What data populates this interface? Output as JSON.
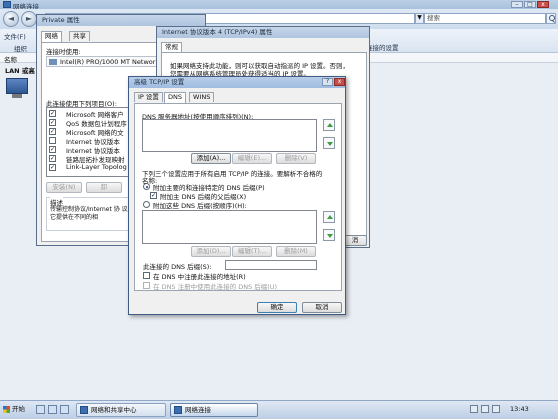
{
  "explorer": {
    "title": "网络连接",
    "search_placeholder": "搜索",
    "menu": [
      "文件(F)",
      "组织"
    ],
    "col_name": "名称",
    "lan_label": "LAN 或高",
    "bg_setting_text": "连接的设置",
    "nav_back": "◄",
    "nav_forward": "►",
    "caption_min": "–",
    "caption_max": "□",
    "caption_close": "x"
  },
  "props_dialog": {
    "title": "Private 属性",
    "tabs": [
      "网络",
      "共享"
    ],
    "connect_using": "连接时使用:",
    "adapter": "Intel(R) PRO/1000 MT Network",
    "items_label": "此连接使用下列项目(O):",
    "items": [
      {
        "checked": "✓",
        "label": "Microsoft 网络客户"
      },
      {
        "checked": "✓",
        "label": "QoS 数据包计划程序"
      },
      {
        "checked": "✓",
        "label": "Microsoft 网络的文"
      },
      {
        "checked": "",
        "label": "Internet 协议版本"
      },
      {
        "checked": "✓",
        "label": "Internet 协议版本"
      },
      {
        "checked": "✓",
        "label": "链路层拓扑发现映射"
      },
      {
        "checked": "✓",
        "label": "Link-Layer Topolog"
      }
    ],
    "install_button": "安装(N)",
    "next_button": "卸",
    "desc_title": "描述",
    "desc_text": "传输控制协议/Internet 协 议。它提供在不同的相"
  },
  "ipv4_dialog": {
    "title": "Internet 协议版本 4 (TCP/IPv4) 属性",
    "tab": "常规",
    "intro_line1": "如果网络支持此功能，则可以获取自动指派的 IP 设置。否则，",
    "intro_line2": "您需要从网络系统管理员处获得适当的 IP 设置。",
    "cancel_partial": "消"
  },
  "tcpip_dialog": {
    "title": "高级 TCP/IP 设置",
    "help": "?",
    "close": "x",
    "tabs": [
      "IP 设置",
      "DNS",
      "WINS"
    ],
    "selected_tab": "DNS",
    "dns_servers_label": "DNS 服务器地址(按使用顺序排列)(N):",
    "add_button": "添加(A)...",
    "edit_button": "编辑(E)...",
    "remove_button": "删除(V)",
    "resolution_text_1": "下列三个设置应用于所有启用 TCP/IP 的连接。要解析不合格的",
    "resolution_text_2": "名称:",
    "radio_primary": "附加主要的和连接特定的 DNS 后缀(P)",
    "check_parent": "附加主 DNS 后缀的父后缀(X)",
    "radio_suffixes": "附加这些 DNS 后缀(按顺序)(H):",
    "add_button_2": "添加(D)...",
    "edit_button_2": "编辑(T)...",
    "remove_button_2": "删除(M)",
    "conn_suffix_label": "此连接的 DNS 后缀(S):",
    "register_check": "在 DNS 中注册此连接的地址(R)",
    "register_suffix_check": "在 DNS 注册中使用此连接的 DNS 后缀(U)",
    "ok_button": "确定",
    "cancel_button": "取消"
  },
  "taskbar": {
    "start": "开始",
    "tasks": [
      "网络和共享中心",
      "网络连接"
    ],
    "active_task": "网络连接",
    "clock": "13:43"
  }
}
